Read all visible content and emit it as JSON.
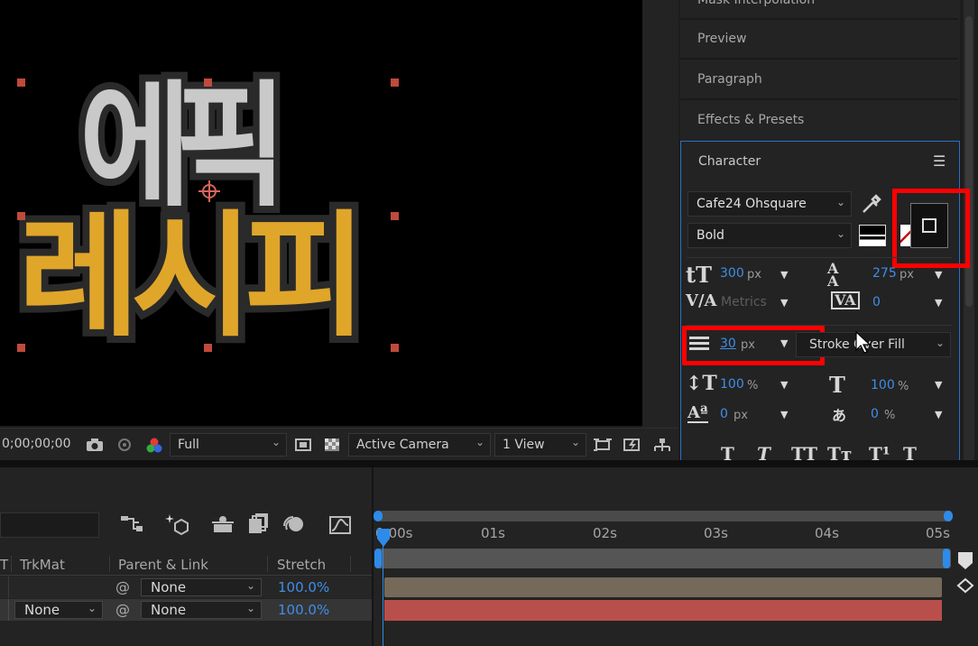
{
  "viewer": {
    "word_top": "에픽",
    "word_bottom": "레시피",
    "toolbar": {
      "timecode": "0;00;00;00",
      "resolution": "Full",
      "camera": "Active Camera",
      "views": "1 View"
    }
  },
  "panels": {
    "mask_interp": "Mask Interpolation",
    "preview": "Preview",
    "paragraph": "Paragraph",
    "effects": "Effects & Presets",
    "character": {
      "title": "Character",
      "font_family": "Cafe24 Ohsquare",
      "font_style": "Bold",
      "font_size": "300",
      "font_size_unit": "px",
      "leading": "275",
      "leading_unit": "px",
      "kerning": "Metrics",
      "tracking": "0",
      "stroke_width": "30",
      "stroke_unit": "px",
      "stroke_mode": "Stroke Over Fill",
      "vscale": "100",
      "vscale_unit": "%",
      "hscale": "100",
      "hscale_unit": "%",
      "baseline": "0",
      "baseline_unit": "px",
      "tsume": "0",
      "tsume_unit": "%"
    }
  },
  "timeline": {
    "columns": {
      "t": "T",
      "trkmat": "TrkMat",
      "parent": "Parent & Link",
      "stretch": "Stretch"
    },
    "rows": [
      {
        "trkmat": "",
        "parent": "None",
        "stretch": "100.0%"
      },
      {
        "trkmat": "None",
        "parent": "None",
        "stretch": "100.0%"
      }
    ],
    "ruler": [
      "0:00s",
      "01s",
      "02s",
      "03s",
      "04s",
      "05s"
    ]
  },
  "colors": {
    "accent_blue": "#3f8ee8",
    "highlight_red": "#ff0000",
    "layer1": "#75695a",
    "layer2": "#b94f4b"
  }
}
